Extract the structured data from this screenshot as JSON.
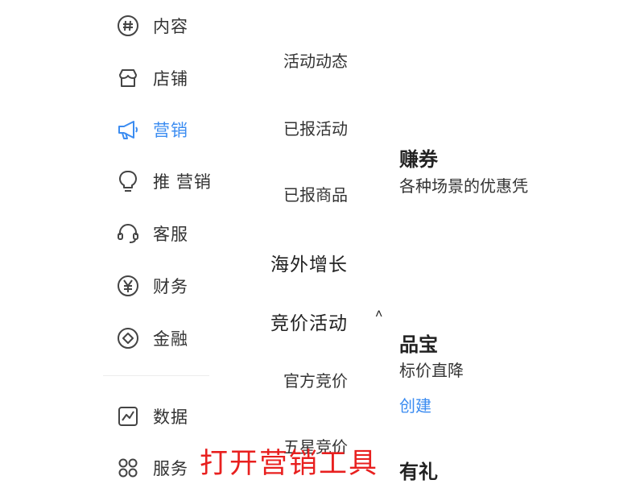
{
  "sidebar": {
    "items": [
      {
        "label": "内容",
        "icon": "hash-icon"
      },
      {
        "label": "店铺",
        "icon": "store-icon"
      },
      {
        "label": "营销",
        "icon": "megaphone-icon",
        "active": true
      },
      {
        "label": "推 营销",
        "icon": "lightbulb-icon"
      },
      {
        "label": "客服",
        "icon": "headset-icon"
      },
      {
        "label": "财务",
        "icon": "yen-icon"
      },
      {
        "label": "金融",
        "icon": "diamond-icon"
      },
      {
        "label": "数据",
        "icon": "chart-icon"
      },
      {
        "label": "服务",
        "icon": "grid-icon"
      }
    ],
    "active_color": "#3b8cf1"
  },
  "submenu": {
    "items": [
      "活动动态",
      "已报活动",
      "已报商品"
    ],
    "overseas_group": "海外增长",
    "bidding_group": "竞价活动",
    "bidding_caret": "˄",
    "bidding_items": [
      "官方竞价",
      "五星竞价"
    ]
  },
  "cards": {
    "coupon_title": "赚券",
    "coupon_desc": "各种场景的优惠凭",
    "treasure_title": "品宝",
    "treasure_desc": "标价直降",
    "treasure_link": "创建",
    "gift_title": "有礼"
  },
  "overlay": {
    "caption": "打开营销工具",
    "color": "#e8201f"
  }
}
